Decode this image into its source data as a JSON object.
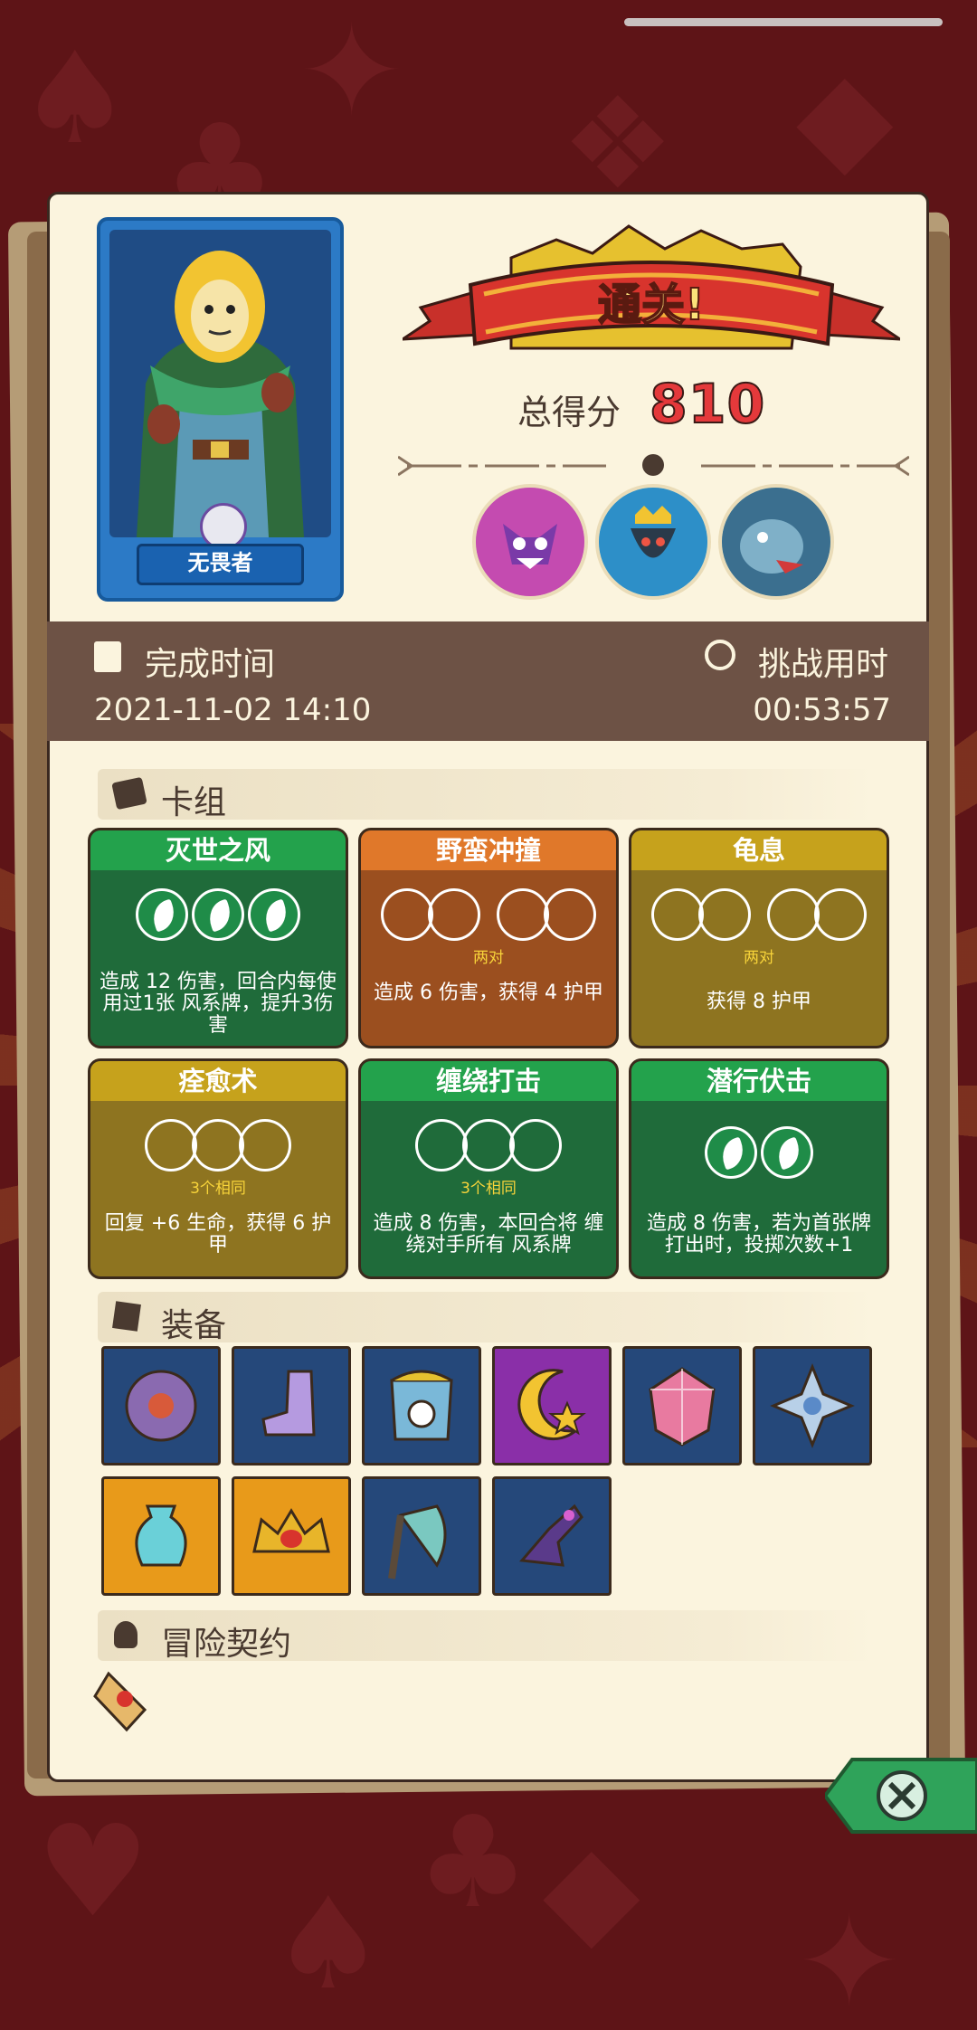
{
  "hero": {
    "name": "无畏者"
  },
  "banner": {
    "title": "通关!"
  },
  "score": {
    "label": "总得分",
    "value": "810"
  },
  "time": {
    "completed_label": "完成时间",
    "completed_value": "2021-11-02 14:10",
    "duration_label": "挑战用时",
    "duration_value": "00:53:57"
  },
  "sections": {
    "deck": "卡组",
    "equipment": "装备",
    "contract": "冒险契约"
  },
  "cards": [
    {
      "title": "灭世之风",
      "req": "",
      "desc": "造成 12 伤害，回合内每使用过1张 风系牌，提升3伤害",
      "color": "green"
    },
    {
      "title": "野蛮冲撞",
      "req": "两对",
      "desc": "造成 6 伤害，获得 4 护甲",
      "color": "orange"
    },
    {
      "title": "龟息",
      "req": "两对",
      "desc": "获得 8 护甲",
      "color": "yellow"
    },
    {
      "title": "痊愈术",
      "req": "3个相同",
      "desc": "回复 +6 生命，获得 6 护甲",
      "color": "yellow"
    },
    {
      "title": "缠绕打击",
      "req": "3个相同",
      "desc": "造成 8 伤害，本回合将 缠绕对手所有 风系牌",
      "color": "green"
    },
    {
      "title": "潜行伏击",
      "req": "",
      "desc": "造成 8 伤害，若为首张牌打出时，投掷次数+1",
      "color": "green"
    }
  ],
  "colors": {
    "green": "#1f6b3a",
    "green_title": "#23a24c",
    "orange": "#9b4f1f",
    "orange_title": "#e0782a",
    "yellow": "#8e7420",
    "yellow_title": "#c6a21c",
    "accent_red": "#e4393b"
  },
  "equipment": [
    {
      "icon": "round-shield-icon",
      "bg": "blue"
    },
    {
      "icon": "boot-icon",
      "bg": "blue"
    },
    {
      "icon": "compass-armor-icon",
      "bg": "blue"
    },
    {
      "icon": "moon-star-icon",
      "bg": "purple"
    },
    {
      "icon": "crystal-dice-icon",
      "bg": "blue"
    },
    {
      "icon": "snowflake-charm-icon",
      "bg": "blue"
    },
    {
      "icon": "vase-icon",
      "bg": "orange"
    },
    {
      "icon": "fire-crown-icon",
      "bg": "orange"
    },
    {
      "icon": "axe-icon",
      "bg": "blue"
    },
    {
      "icon": "dark-gauntlet-icon",
      "bg": "blue"
    }
  ]
}
